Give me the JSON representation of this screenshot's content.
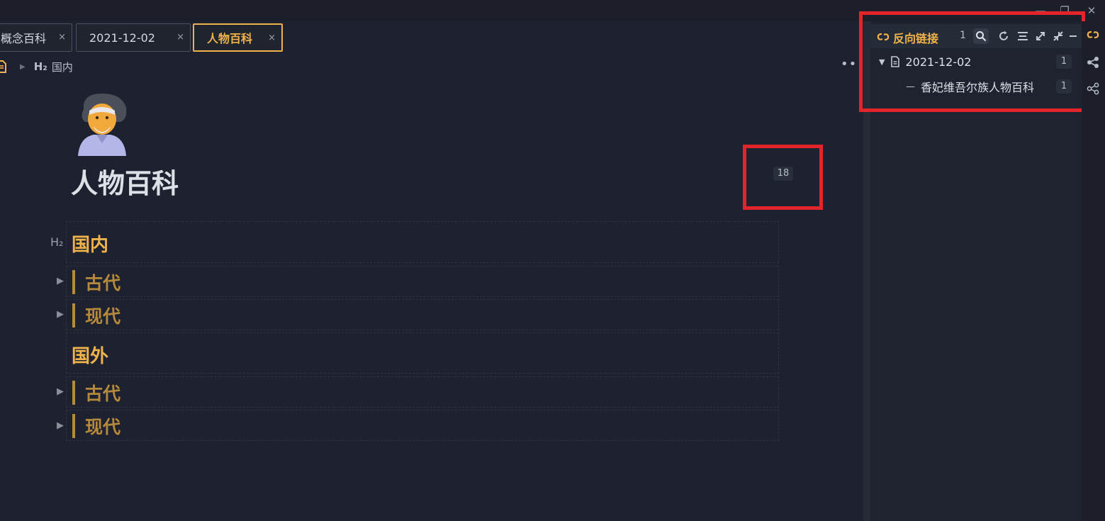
{
  "window": {
    "minimize_icon": "minimize-icon",
    "restore_icon": "restore-icon",
    "close_icon": "close-icon",
    "minimize_glyph": "—",
    "restore_glyph": "❐",
    "close_glyph": "✕"
  },
  "tabs": [
    {
      "label": "概念百科",
      "close": "×",
      "active": false
    },
    {
      "label": "2021-12-02",
      "close": "×",
      "active": false
    },
    {
      "label": "人物百科",
      "close": "×",
      "active": true
    }
  ],
  "breadcrumb": {
    "doc_icon": "document-icon",
    "separator": "▶",
    "heading_marker": "H₂",
    "heading_label": "国内"
  },
  "more_glyph": "•••",
  "document": {
    "icon": "person-emoji",
    "title": "人物百科",
    "word_count_badge": "18",
    "heading_marker": "H₂",
    "sections": [
      {
        "heading": "国内",
        "subsections": [
          "古代",
          "现代"
        ]
      },
      {
        "heading": "国外",
        "subsections": [
          "古代",
          "现代"
        ]
      }
    ]
  },
  "backlinks_panel": {
    "title": "反向链接",
    "count": "1",
    "toolbar_icons": [
      "search-icon",
      "refresh-icon",
      "align-icon",
      "expand-icon",
      "collapse-icon",
      "minimize-icon"
    ],
    "tree": [
      {
        "label": "2021-12-02",
        "count": "1",
        "expanded": true,
        "toggle": "▼"
      },
      {
        "label": "香妃维吾尔族人物百科",
        "count": "1",
        "prefix": "—"
      }
    ]
  },
  "dock_icons": [
    "backlink-icon",
    "graph-icon",
    "global-graph-icon"
  ],
  "colors": {
    "accent": "#f0b24a",
    "heading_h3": "#b68a3a",
    "highlight_box": "#e3242b",
    "background": "#1e2230"
  }
}
